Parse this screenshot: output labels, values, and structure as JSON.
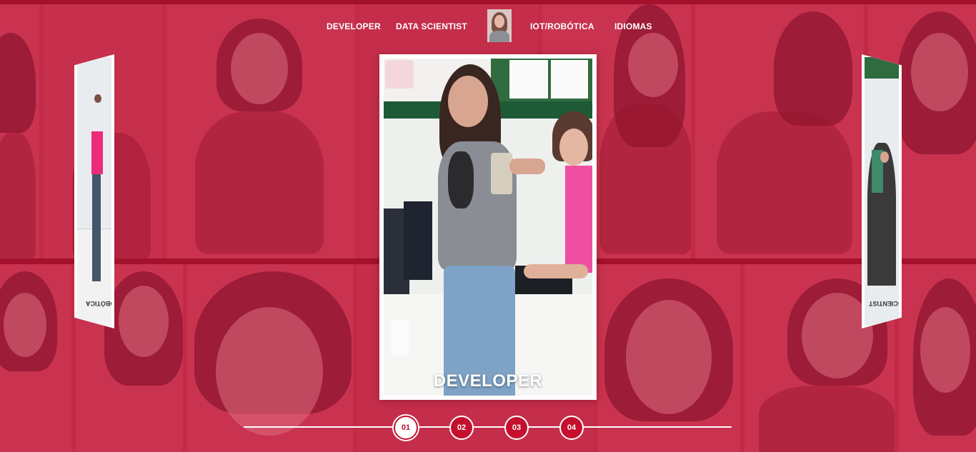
{
  "nav": {
    "items": [
      {
        "label": "DEVELOPER"
      },
      {
        "label": "DATA SCIENTIST"
      },
      {
        "label": "IOT/ROBÓTICA"
      },
      {
        "label": "IDIOMAS"
      }
    ]
  },
  "slider": {
    "main_caption": "DEVELOPER",
    "left_card_label": "IOT/ROBÓTICA",
    "right_card_label": "DATA SCIENTIST"
  },
  "pager": {
    "pages": [
      "01",
      "02",
      "03",
      "04"
    ],
    "active": "01"
  },
  "colors": {
    "background": "#c22a45",
    "accent": "#c4102e",
    "text": "#ffffff"
  },
  "icons": {
    "avatar": "profile-photo"
  }
}
